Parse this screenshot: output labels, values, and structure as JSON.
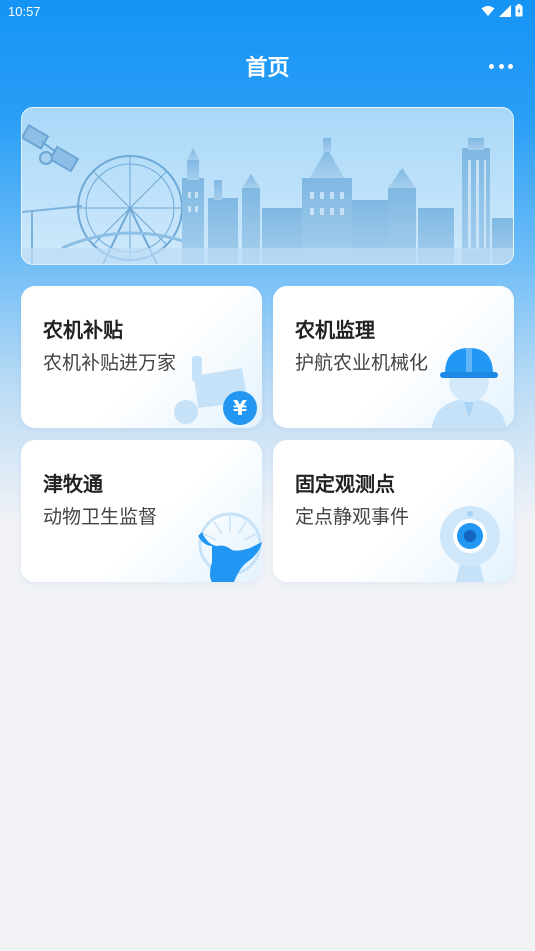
{
  "status_bar": {
    "time": "10:57"
  },
  "header": {
    "title": "首页"
  },
  "cards": [
    {
      "title": "农机补贴",
      "subtitle": "农机补贴进万家",
      "icon": "tractor-icon"
    },
    {
      "title": "农机监理",
      "subtitle": "护航农业机械化",
      "icon": "worker-helmet-icon"
    },
    {
      "title": "津牧通",
      "subtitle": "动物卫生监督",
      "icon": "cattle-icon"
    },
    {
      "title": "固定观测点",
      "subtitle": "定点静观事件",
      "icon": "webcam-icon"
    }
  ],
  "colors": {
    "primary": "#1594f5",
    "card_accent": "#2196f3",
    "page_bg": "#f0f2f6"
  }
}
